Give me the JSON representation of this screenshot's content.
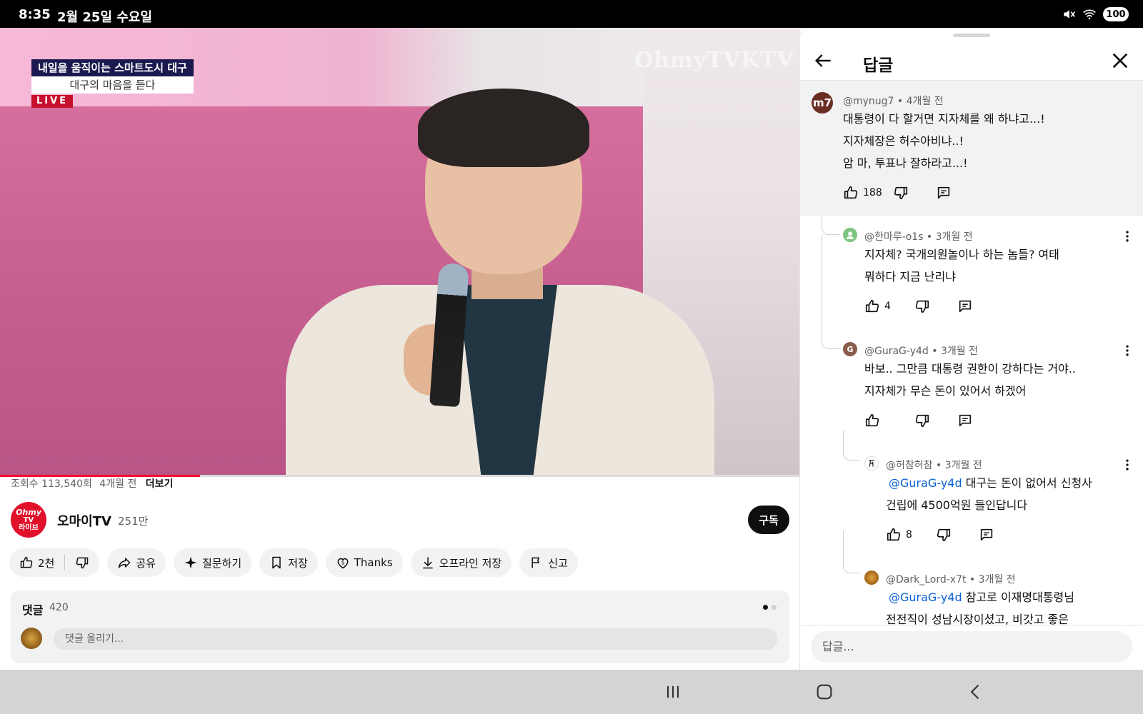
{
  "status": {
    "time": "8:35",
    "date": "2월 25일 수요일",
    "battery": "100"
  },
  "video": {
    "caption_line1": "내일을 움직이는 스마트도시 대구",
    "caption_line2": "대구의 마음을 듣다",
    "live": "LIVE",
    "watermark": "OhmyTVKTV",
    "progress": 0.25
  },
  "info": {
    "views": "조회수 113,540회",
    "age": "4개월 전",
    "more": "더보기",
    "channel_name": "오마이TV",
    "channel_avatar_line1": "Ohmy",
    "channel_avatar_line2": "TV",
    "channel_avatar_line3": "라이브",
    "subscribers": "251만",
    "subscribe": "구독"
  },
  "actions": {
    "likes": "2천",
    "share": "공유",
    "ask": "질문하기",
    "save": "저장",
    "thanks": "Thanks",
    "offline": "오프라인 저장",
    "report": "신고"
  },
  "comments": {
    "title": "댓글",
    "count": "420",
    "placeholder": "댓글 올리기..."
  },
  "panel": {
    "title": "답글",
    "reply_placeholder": "답글...",
    "top_comment": {
      "avatar": "m7",
      "author": "@mynug7 • 4개월 전",
      "lines": [
        "대통령이 다 할거면 지자체를 왜 하냐고...!",
        "지자체장은 허수아비냐..!",
        "암 마, 투표나 잘하라고...!"
      ],
      "likes": "188"
    },
    "replies": [
      {
        "author": "@한마루-o1s • 3개월 전",
        "lines": [
          "지자체?  국개의원놀이나 하는 놈들? 여태",
          "뭐하다 지금 난리냐"
        ],
        "likes": "4"
      },
      {
        "avatar": "G",
        "author": "@GuraG-y4d • 3개월 전",
        "lines": [
          "바보.. 그만큼 대통령 권한이 강하다는 거야..",
          "지자체가 무슨 돈이 있어서 하겠어"
        ],
        "likes": ""
      },
      {
        "author": "@허참허참 • 3개월 전",
        "mention": "@GuraG-y4d",
        "line1_rest": " 대구는 돈이 없어서 신청사",
        "line2": "건립에 4500억원 들인답니다",
        "likes": "8"
      },
      {
        "author": "@Dark_Lord-x7t • 3개월 전",
        "mention": "@GuraG-y4d",
        "line1_rest": " 참고로 이재명대통령님",
        "line2": "전전직이 성남시장이셨고, 비갓고 좋은"
      }
    ]
  },
  "colors": {
    "accent": "#ff0033",
    "link": "#065fd4",
    "dark": "#0f0f0f",
    "muted": "#606060"
  }
}
